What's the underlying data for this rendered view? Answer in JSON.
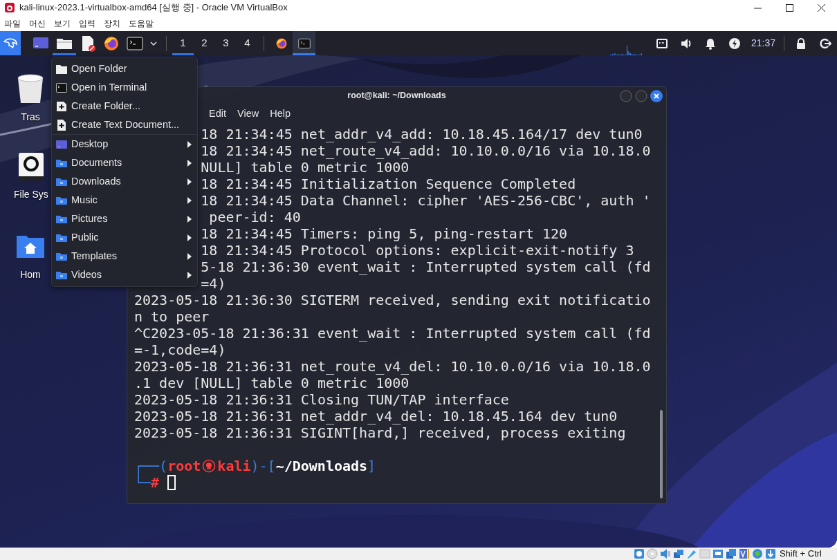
{
  "window": {
    "title": "kali-linux-2023.1-virtualbox-amd64 [실행 중] - Oracle VM VirtualBox"
  },
  "menubar": [
    "파일",
    "머신",
    "보기",
    "입력",
    "장치",
    "도움말"
  ],
  "panel": {
    "launchers": [
      {
        "kind": "desktop",
        "selected": false
      },
      {
        "kind": "files",
        "selected": true
      },
      {
        "kind": "editor",
        "selected": false
      },
      {
        "kind": "browser",
        "selected": false
      },
      {
        "kind": "terminal",
        "selected": false
      }
    ],
    "workspaces": [
      {
        "label": "1",
        "selected": true
      },
      {
        "label": "2",
        "selected": false
      },
      {
        "label": "3",
        "selected": false
      },
      {
        "label": "4",
        "selected": false
      }
    ],
    "tasks": [
      {
        "kind": "browser",
        "selected": false
      },
      {
        "kind": "terminal",
        "selected": true
      }
    ],
    "clock": "21:37"
  },
  "desktop_icons": [
    {
      "kind": "trash",
      "label": "Tras"
    },
    {
      "kind": "drive",
      "label": "File Sys"
    },
    {
      "kind": "home",
      "label": "Hom"
    }
  ],
  "context_menu": {
    "items": [
      {
        "kind": "open",
        "label": "Open Folder",
        "submenu": false
      },
      {
        "kind": "terminal",
        "label": "Open in Terminal",
        "submenu": false
      },
      {
        "kind": "newfolder",
        "label": "Create Folder...",
        "submenu": false
      },
      {
        "kind": "newdoc",
        "label": "Create Text Document...",
        "submenu": false
      },
      {
        "kind": "desktop",
        "label": "Desktop",
        "submenu": true
      },
      {
        "kind": "folder",
        "label": "Documents",
        "submenu": true
      },
      {
        "kind": "folder",
        "label": "Downloads",
        "submenu": true
      },
      {
        "kind": "folder",
        "label": "Music",
        "submenu": true
      },
      {
        "kind": "folder",
        "label": "Pictures",
        "submenu": true
      },
      {
        "kind": "folder",
        "label": "Public",
        "submenu": true
      },
      {
        "kind": "folder",
        "label": "Templates",
        "submenu": true
      },
      {
        "kind": "folder",
        "label": "Videos",
        "submenu": true
      }
    ]
  },
  "terminal": {
    "title": "root@kali: ~/Downloads",
    "menus": [
      "Edit",
      "View",
      "Help"
    ],
    "lines": [
      {
        "kind": "covered",
        "text": "18 21:34:45 net_addr_v4_add: 10.18.45.164/17 dev tun0"
      },
      {
        "kind": "covered",
        "text": "18 21:34:45 net_route_v4_add: 10.10.0.0/16 via 10.18.0"
      },
      {
        "kind": "covered",
        "text": "NULL] table 0 metric 1000"
      },
      {
        "kind": "covered",
        "text": "18 21:34:45 Initialization Sequence Completed"
      },
      {
        "kind": "covered",
        "text": "18 21:34:45 Data Channel: cipher 'AES-256-CBC', auth '"
      },
      {
        "kind": "covered",
        "text": " peer-id: 40"
      },
      {
        "kind": "covered",
        "text": "18 21:34:45 Timers: ping 5, ping-restart 120"
      },
      {
        "kind": "covered",
        "text": "18 21:34:45 Protocol options: explicit-exit-notify 3"
      },
      {
        "kind": "covered",
        "text": "5-18 21:36:30 event_wait : Interrupted system call (fd"
      },
      {
        "kind": "covered",
        "text": "=4)"
      },
      {
        "kind": "full",
        "text": "2023-05-18 21:36:30 SIGTERM received, sending exit notificatio"
      },
      {
        "kind": "full",
        "text": "n to peer"
      },
      {
        "kind": "full",
        "text": "^C2023-05-18 21:36:31 event_wait : Interrupted system call (fd"
      },
      {
        "kind": "full",
        "text": "=-1,code=4)"
      },
      {
        "kind": "full",
        "text": "2023-05-18 21:36:31 net_route_v4_del: 10.10.0.0/16 via 10.18.0"
      },
      {
        "kind": "full",
        "text": ".1 dev [NULL] table 0 metric 1000"
      },
      {
        "kind": "full",
        "text": "2023-05-18 21:36:31 Closing TUN/TAP interface"
      },
      {
        "kind": "full",
        "text": "2023-05-18 21:36:31 net_addr_v4_del: 10.18.45.164 dev tun0"
      },
      {
        "kind": "full",
        "text": "2023-05-18 21:36:31 SIGINT[hard,] received, process exiting"
      }
    ],
    "prompt": {
      "open": "┌──(",
      "user": "root",
      "host": "kali",
      "mid": ")-[",
      "path": "~/Downloads",
      "close": "]",
      "bottom": "└─",
      "symbol": "#"
    }
  },
  "status_bar": {
    "hint": "Shift + Ctrl"
  }
}
